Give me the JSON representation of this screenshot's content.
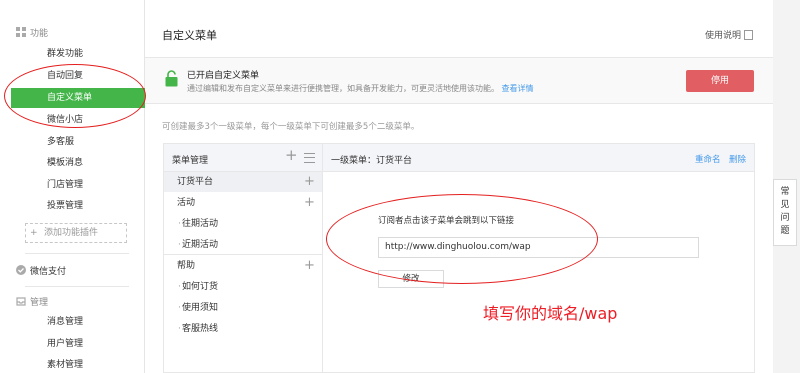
{
  "sidebar": {
    "section_features": "功能",
    "features": [
      "群发功能",
      "自动回复",
      "自定义菜单",
      "微信小店",
      "多客服",
      "模板消息",
      "门店管理",
      "投票管理"
    ],
    "add_plugin": "添加功能插件",
    "section_pay": "微信支付",
    "section_manage": "管理",
    "manage": [
      "消息管理",
      "用户管理",
      "素材管理"
    ]
  },
  "header": {
    "title": "自定义菜单",
    "help": "使用说明"
  },
  "status": {
    "title": "已开启自定义菜单",
    "desc": "通过编辑和发布自定义菜单来进行便携管理，如具备开发能力，可更灵活地使用该功能。",
    "link": "查看详情",
    "button": "停用"
  },
  "tip": "可创建最多3个一级菜单，每个一级菜单下可创建最多5个二级菜单。",
  "menu": {
    "title": "菜单管理",
    "groups": [
      {
        "label": "订货平台",
        "children": []
      },
      {
        "label": "活动",
        "children": [
          "往期活动",
          "近期活动"
        ]
      },
      {
        "label": "帮助",
        "children": [
          "如何订货",
          "使用须知",
          "客服热线"
        ]
      }
    ]
  },
  "detail": {
    "title": "一级菜单：订货平台",
    "rename": "重命名",
    "delete": "删除",
    "jump_label": "订阅者点击该子菜单会跳到以下链接",
    "url": "http://www.dinghuolou.com/wap",
    "edit_button": "修改"
  },
  "annotation": "填写你的域名/wap",
  "faq": [
    "常",
    "见",
    "问",
    "题"
  ],
  "colors": {
    "accent_green": "#44b549",
    "danger": "#e15f63",
    "link": "#459ae9",
    "annotation_red": "#ee1c25"
  }
}
